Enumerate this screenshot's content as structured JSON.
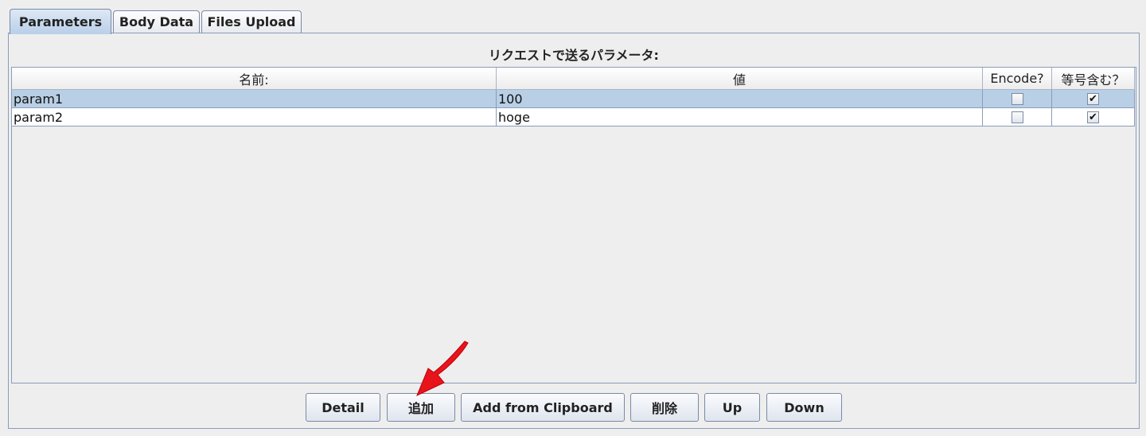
{
  "tabs": [
    {
      "label": "Parameters",
      "active": true
    },
    {
      "label": "Body Data",
      "active": false
    },
    {
      "label": "Files Upload",
      "active": false
    }
  ],
  "panel": {
    "title": "リクエストで送るパラメータ:"
  },
  "table": {
    "columns": [
      "名前:",
      "値",
      "Encode?",
      "等号含む？"
    ],
    "rows": [
      {
        "name": "param1",
        "value": "100",
        "encode": false,
        "include_equals": true,
        "selected": true
      },
      {
        "name": "param2",
        "value": "hoge",
        "encode": false,
        "include_equals": true,
        "selected": false
      }
    ],
    "check_mark": "✔"
  },
  "buttons": {
    "detail": "Detail",
    "add": "追加",
    "add_from_clipboard": "Add from Clipboard",
    "delete": "削除",
    "up": "Up",
    "down": "Down"
  },
  "colors": {
    "selection": "#b8cfe5",
    "arrow": "#e8141b"
  }
}
